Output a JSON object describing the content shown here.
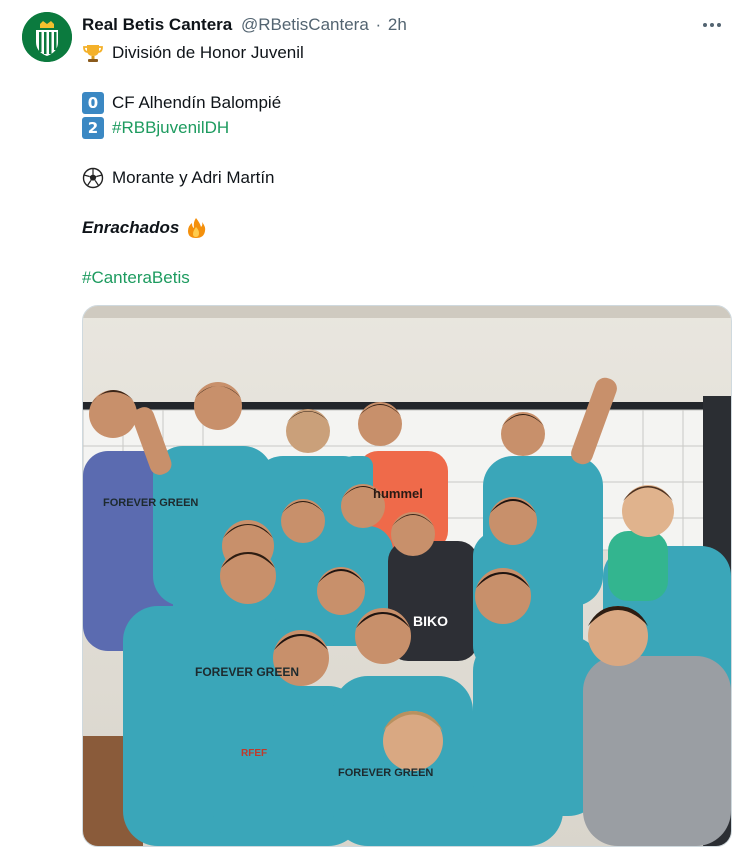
{
  "tweet": {
    "author_name": "Real Betis Cantera",
    "author_handle": "@RBetisCantera",
    "separator": "·",
    "timestamp": "2h",
    "more_icon": "more-horizontal-icon",
    "lines": {
      "competition": "División de Honor Juvenil",
      "home_score": "0",
      "home_team": "CF Alhendín Balompié",
      "away_score": "2",
      "away_hashtag": "#RBBjuvenilDH",
      "scorers": "Morante y Adri Martín",
      "tagline": "Enrachados",
      "closing_hashtag": "#CanteraBetis"
    },
    "media": {
      "shirt_sponsor": "FOREVER GREEN",
      "bib_text": "hummel",
      "shirt_text": "BIKO",
      "badge_text": "RFEF"
    }
  },
  "colors": {
    "accent_green": "#1d9b5f",
    "keycap_blue": "#3b88c3",
    "kit_teal": "#3aa6b9"
  }
}
